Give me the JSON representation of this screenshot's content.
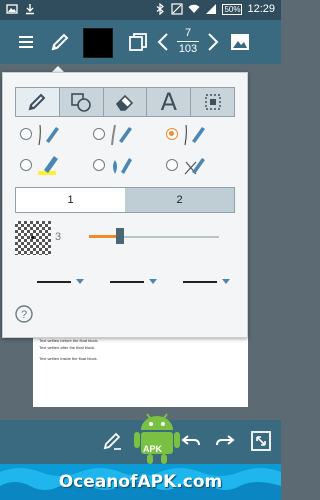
{
  "status_bar": {
    "battery": "50",
    "time": "12:29",
    "icons": [
      "image-icon",
      "download-icon",
      "bluetooth-icon",
      "mute-icon",
      "wifi-icon",
      "signal-icon",
      "battery-icon"
    ]
  },
  "toolbar": {
    "icons": [
      "menu-icon",
      "pen-icon",
      "color-swatch",
      "pages-icon",
      "prev-icon",
      "next-icon",
      "image-icon"
    ],
    "page_current": "7",
    "page_total": "103",
    "color": "#000000"
  },
  "popup": {
    "tools": [
      "pen-tool",
      "shape-tool",
      "eraser-tool",
      "text-tool",
      "select-tool"
    ],
    "active_tool": 0,
    "pen_types": [
      "fountain-pen",
      "soft-pen",
      "ballpoint-pen",
      "highlighter",
      "ink-drop-pen",
      "crossed-pen"
    ],
    "selected_pen": 2,
    "segments": [
      "1",
      "2"
    ],
    "active_segment": 1,
    "size_value": "3",
    "size_level_percent": 22,
    "accent": "#f08a2a"
  },
  "document": {
    "lines": [
      "Text written before the float block.",
      "Text written after the float block.",
      "Text written inside the float block."
    ]
  },
  "bottom_bar": {
    "icons": [
      "edit-icon",
      "undo-icon",
      "redo-icon",
      "fullscreen-icon"
    ]
  },
  "banner": {
    "text": "OceanofAPK.com",
    "robot_label": "APK"
  }
}
